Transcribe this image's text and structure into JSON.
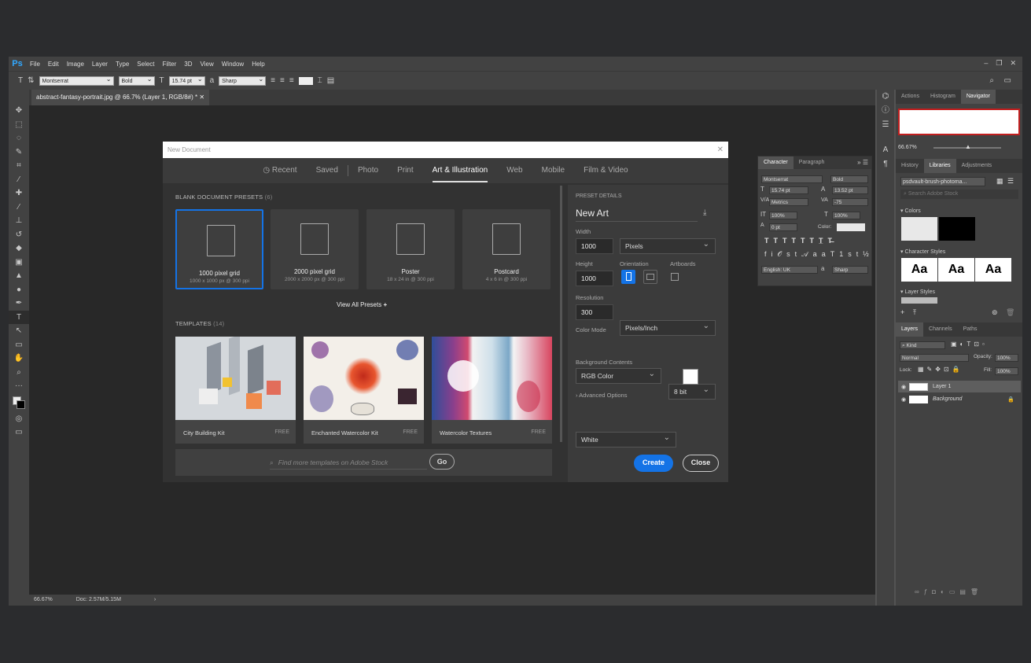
{
  "menubar": {
    "logo": "Ps",
    "items": [
      "File",
      "Edit",
      "Image",
      "Layer",
      "Type",
      "Select",
      "Filter",
      "3D",
      "View",
      "Window",
      "Help"
    ]
  },
  "options": {
    "font": "Montserrat",
    "style": "Bold",
    "size": "15.74 pt",
    "aa": "Sharp"
  },
  "doc": {
    "tab": "abstract-fantasy-portrait.jpg @ 66.7% (Layer 1, RGB/8#) *",
    "zoom": "66.67%",
    "info": "Doc: 2.57M/5.15M"
  },
  "dialog": {
    "title": "New Document",
    "tabs": [
      "Recent",
      "Saved",
      "Photo",
      "Print",
      "Art & Illustration",
      "Web",
      "Mobile",
      "Film & Video"
    ],
    "presets_heading": "BLANK DOCUMENT PRESETS",
    "presets_count": "(6)",
    "presets": [
      {
        "name": "1000 pixel grid",
        "sub": "1000 x 1000 px @ 300 ppi"
      },
      {
        "name": "2000 pixel grid",
        "sub": "2000 x 2000 px @ 300 ppi"
      },
      {
        "name": "Poster",
        "sub": "18 x 24 in @ 300 ppi"
      },
      {
        "name": "Postcard",
        "sub": "4 x 6 in @ 300 ppi"
      }
    ],
    "view_all": "View All Presets",
    "templates_heading": "TEMPLATES",
    "templates_count": "(14)",
    "templates": [
      {
        "name": "City Building Kit",
        "tag": "FREE"
      },
      {
        "name": "Enchanted Watercolor Kit",
        "tag": "FREE"
      },
      {
        "name": "Watercolor Textures",
        "tag": "FREE"
      }
    ],
    "search_placeholder": "Find more templates on Adobe Stock",
    "go": "Go",
    "details": {
      "heading": "PRESET DETAILS",
      "name": "New Art",
      "width_label": "Width",
      "width": "1000",
      "unit": "Pixels",
      "height_label": "Height",
      "height": "1000",
      "orientation_label": "Orientation",
      "artboards_label": "Artboards",
      "res_label": "Resolution",
      "res": "300",
      "res_unit": "Pixels/Inch",
      "color_label": "Color Mode",
      "color_mode": "RGB Color",
      "bit": "8 bit",
      "bg_label": "Background Contents",
      "bg": "White",
      "advanced": "Advanced Options"
    },
    "create": "Create",
    "close": "Close"
  },
  "character": {
    "tabs": [
      "Character",
      "Paragraph"
    ],
    "font": "Montserrat",
    "style": "Bold",
    "size": "15.74 pt",
    "leading": "13.52 pt",
    "kern": "Metrics",
    "track": "-75",
    "vscale": "100%",
    "hscale": "100%",
    "baseline": "0 pt",
    "color_label": "Color:",
    "lang": "English: UK",
    "aa": "Sharp"
  },
  "right": {
    "tabs1": [
      "Actions",
      "Histogram",
      "Navigator"
    ],
    "nav_zoom": "66.67%",
    "tabs2": [
      "History",
      "Libraries",
      "Adjustments"
    ],
    "library": "psdvault-brush-photoma...",
    "search": "Search Adobe Stock",
    "colors": "Colors",
    "char_styles": "Character Styles",
    "aa": "Aa",
    "layer_styles": "Layer Styles",
    "tabs3": [
      "Layers",
      "Channels",
      "Paths"
    ],
    "kind": "Kind",
    "blend": "Normal",
    "opacity_label": "Opacity:",
    "opacity": "100%",
    "lock_label": "Lock:",
    "fill_label": "Fill:",
    "fill": "100%",
    "layers": [
      "Layer 1",
      "Background"
    ]
  }
}
